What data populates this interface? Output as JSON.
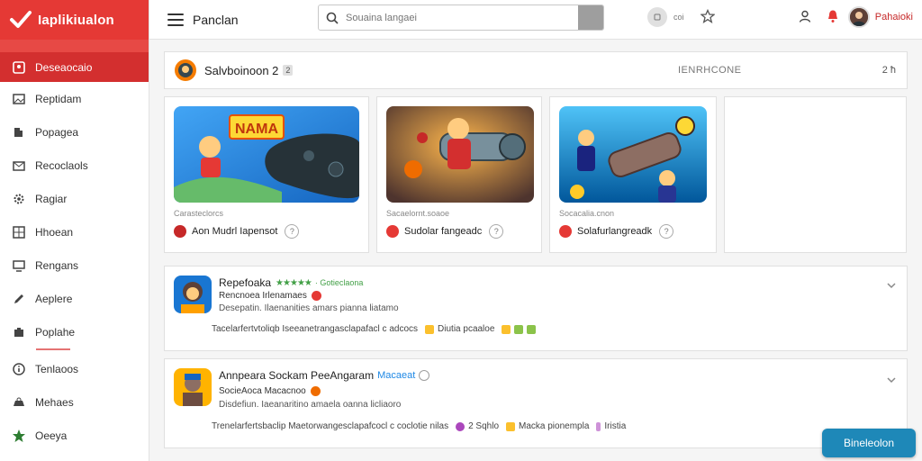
{
  "brand": {
    "name": "Iaplikiualon",
    "color": "#e53935"
  },
  "sidebar": {
    "items": [
      {
        "label": "Deseaocaio",
        "icon": "user-icon",
        "active": true
      },
      {
        "label": "Reptidam",
        "icon": "image-icon"
      },
      {
        "label": "Popagea",
        "icon": "puzzle-icon"
      },
      {
        "label": "Recoclaols",
        "icon": "mail-icon"
      },
      {
        "label": "Ragiar",
        "icon": "gear-icon"
      },
      {
        "label": "Hhoean",
        "icon": "grid-icon"
      },
      {
        "label": "Rengans",
        "icon": "monitor-icon"
      },
      {
        "label": "Aeplere",
        "icon": "pencil-icon"
      },
      {
        "label": "Poplahe",
        "icon": "box-icon"
      },
      {
        "label": "Tenlaoos",
        "icon": "info-icon"
      },
      {
        "label": "Mehaes",
        "icon": "cart-icon"
      },
      {
        "label": "Oeeya",
        "icon": "star-icon"
      }
    ]
  },
  "topbar": {
    "title": "Panclan",
    "search_placeholder": "Souaina langaei",
    "small_label": "coi",
    "user_name": "Pahaioki"
  },
  "featured": {
    "title": "Salvboinoon 2",
    "badge": "2",
    "mid_label": "IENRHCONE",
    "right_label": "2 ħ"
  },
  "cards": [
    {
      "banner": "NAMA",
      "meta": "Carasteclorcs",
      "title": "Aon Mudrl Iapensot",
      "dot_color": "#c62828"
    },
    {
      "meta": "Sacaelornt.soaoe",
      "title": "Sudolar fangeadc",
      "dot_color": "#e53935"
    },
    {
      "meta": "Socacalia.cnon",
      "title": "Solafurlangreadk",
      "dot_color": "#e53935"
    }
  ],
  "list": [
    {
      "title": "Repefoaka",
      "stars": "★★★★★",
      "tag": "· Gotieclaona",
      "sub": "Rencnoea Irlenamaes",
      "sub2": "Desepatin. Ilaenanities amars pianna liatamo",
      "desc": "Tacelarfertvtoliqb Iseeanetrangasclapafacl c adcocs",
      "badges": [
        {
          "label": "Diutia pcaaloe",
          "color": "#fbc02d"
        },
        {
          "label": "",
          "color": "#8bc34a"
        }
      ]
    },
    {
      "title": "Annpeara Sockam PeeAngaram",
      "tag2": "Macaeat",
      "sub": "SocieAoca Macacnoo",
      "sub2": "Disdefiun. Iaeanaritino amaela oanna licliaoro",
      "desc": "Trenelarfertsbaclip Maetorwangesclapafcocl c coclotie nilas",
      "badges": [
        {
          "label": "2 Sqhlo",
          "color": "#ab47bc"
        },
        {
          "label": "Macka pionempla",
          "color": "#fbc02d"
        },
        {
          "label": "Iristia",
          "color": "#ce93d8"
        }
      ]
    }
  ],
  "float_button": {
    "label": "Bineleolon"
  }
}
